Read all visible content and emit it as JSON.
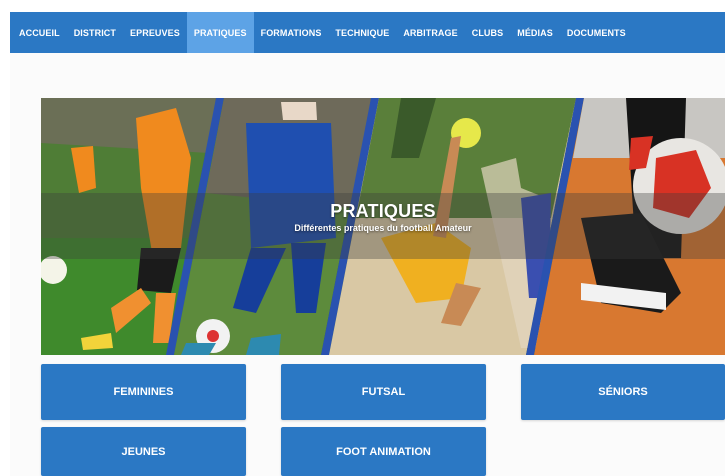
{
  "nav": {
    "items": [
      {
        "label": "ACCUEIL",
        "active": false
      },
      {
        "label": "DISTRICT",
        "active": false
      },
      {
        "label": "EPREUVES",
        "active": false
      },
      {
        "label": "PRATIQUES",
        "active": true
      },
      {
        "label": "FORMATIONS",
        "active": false
      },
      {
        "label": "TECHNIQUE",
        "active": false
      },
      {
        "label": "ARBITRAGE",
        "active": false
      },
      {
        "label": "CLUBS",
        "active": false
      },
      {
        "label": "MÉDIAS",
        "active": false
      },
      {
        "label": "DOCUMENTS",
        "active": false
      }
    ]
  },
  "banner": {
    "title": "PRATIQUES",
    "subtitle": "Différentes pratiques du football Amateur"
  },
  "categories": [
    {
      "label": "FEMININES"
    },
    {
      "label": "FUTSAL"
    },
    {
      "label": "SÉNIORS"
    },
    {
      "label": "JEUNES"
    },
    {
      "label": "FOOT ANIMATION"
    }
  ],
  "colors": {
    "primary": "#2b78c4",
    "nav_active": "#5da3e6",
    "divider": "#2a52b0"
  }
}
